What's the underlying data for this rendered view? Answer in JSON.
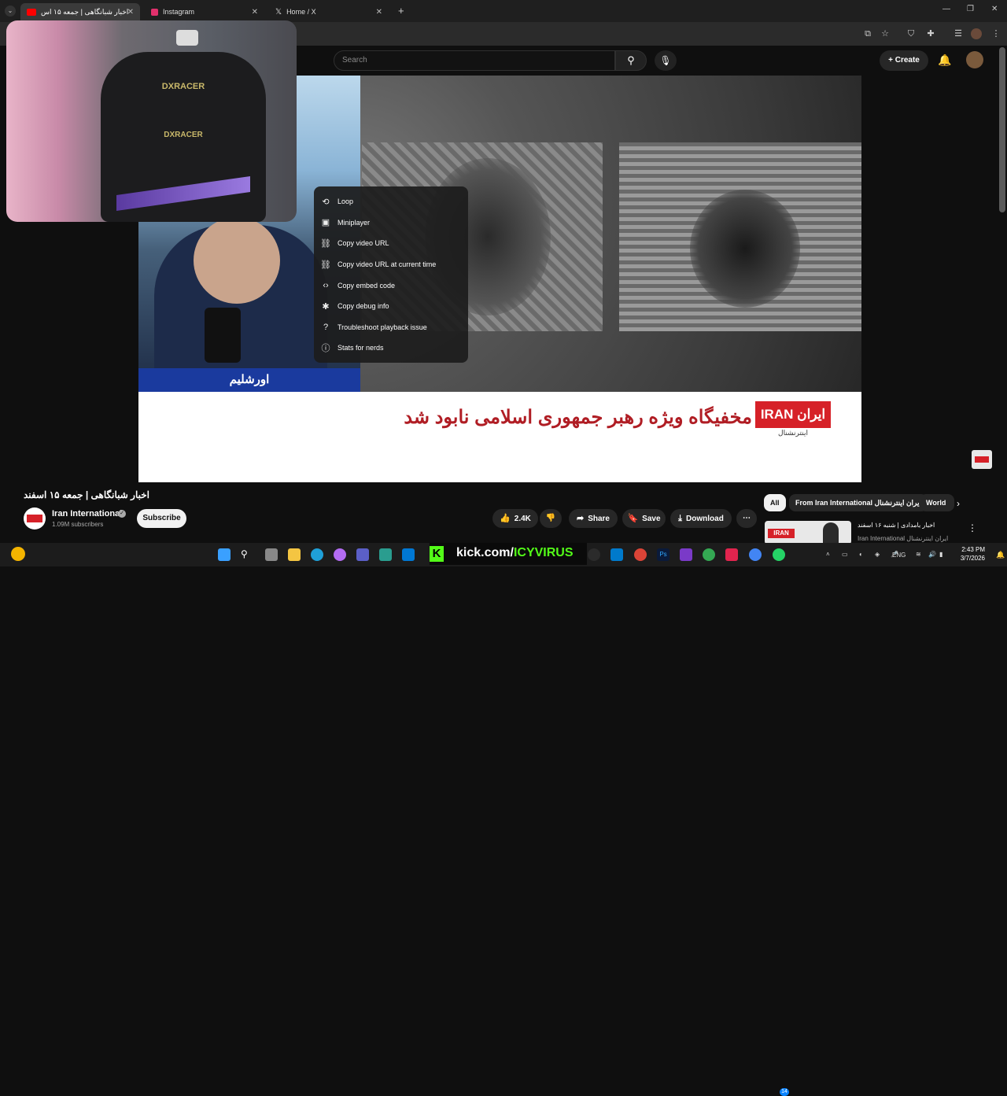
{
  "browser": {
    "tabs": [
      {
        "label": "اخبار شبانگاهی | جمعه ۱۵ اس",
        "favicon_color": "#ff0000",
        "active": true
      },
      {
        "label": "Instagram",
        "favicon_color": "#e1306c",
        "active": false
      },
      {
        "label": "Home / X",
        "favicon_color": "#000000",
        "active": false
      }
    ],
    "new_tab": "+"
  },
  "youtube": {
    "search_placeholder": "Search",
    "create_label": "Create"
  },
  "video": {
    "location_caption": "اورشلیم",
    "headline": "مخفیگاه ویژه رهبر جمهوری اسلامی نابود شد",
    "brand_logo": "IRAN ایران",
    "brand_sub": "اینترنشنال"
  },
  "webcam": {
    "chair_brand": "DXRACER",
    "chair_brand2": "DXRACER"
  },
  "context_menu": {
    "items": [
      {
        "label": "Loop",
        "icon": "loop-icon"
      },
      {
        "label": "Miniplayer",
        "icon": "miniplayer-icon"
      },
      {
        "label": "Copy video URL",
        "icon": "link-icon"
      },
      {
        "label": "Copy video URL at current time",
        "icon": "link-icon"
      },
      {
        "label": "Copy embed code",
        "icon": "code-icon"
      },
      {
        "label": "Copy debug info",
        "icon": "debug-icon"
      },
      {
        "label": "Troubleshoot playback issue",
        "icon": "help-icon"
      },
      {
        "label": "Stats for nerds",
        "icon": "info-icon"
      }
    ]
  },
  "details": {
    "title": "اخبار شبانگاهی | جمعه ۱۵ اسفند",
    "channel": "Iran International",
    "subscribers": "1.09M subscribers",
    "subscribe": "Subscribe",
    "likes": "2.4K",
    "share": "Share",
    "save": "Save",
    "download": "Download"
  },
  "sidebar": {
    "chips": [
      "All",
      "From Iran International ایران اینترنشنال",
      "World"
    ],
    "rec_title": "اخبار بامدادی | شنبه ۱۶ اسفند",
    "rec_channel": "Iran International ایران اینترنشنال"
  },
  "taskbar": {
    "kick_text_a": "kick.com/",
    "kick_text_b": "ICYVIRUS",
    "lang": "ENG",
    "time": "2:43 PM",
    "date": "3/7/2026",
    "badge_count": "14"
  }
}
